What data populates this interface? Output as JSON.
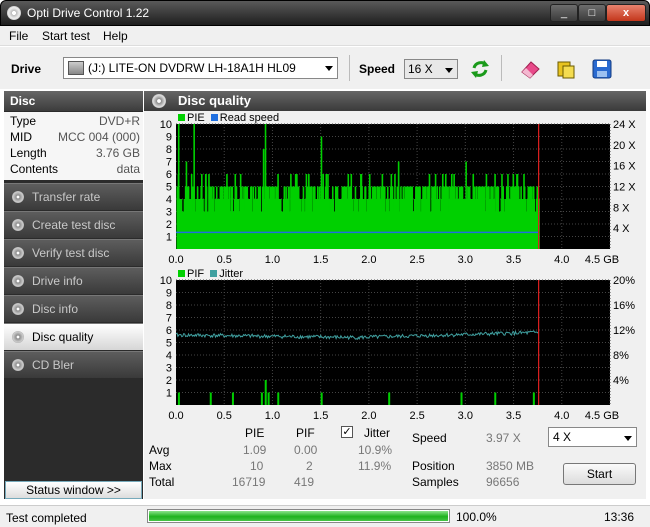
{
  "window": {
    "title": "Opti Drive Control 1.22",
    "min": "_",
    "max": "□",
    "close": "x"
  },
  "menu": [
    "File",
    "Start test",
    "Help"
  ],
  "toolbar": {
    "drive_label": "Drive",
    "drive_value": "(J:)  LITE-ON DVDRW LH-18A1H HL09",
    "speed_label": "Speed",
    "speed_value": "16 X",
    "buttons": [
      "refresh-icon",
      "eraser-icon",
      "copy-icon",
      "save-icon"
    ]
  },
  "sidebar": {
    "header": "Disc",
    "info": [
      {
        "key": "Type",
        "value": "DVD+R"
      },
      {
        "key": "MID",
        "value": "MCC 004 (000)"
      },
      {
        "key": "Length",
        "value": "3.76 GB"
      },
      {
        "key": "Contents",
        "value": "data"
      }
    ],
    "nav": [
      {
        "label": "Transfer rate",
        "active": false
      },
      {
        "label": "Create test disc",
        "active": false
      },
      {
        "label": "Verify test disc",
        "active": false
      },
      {
        "label": "Drive info",
        "active": false
      },
      {
        "label": "Disc info",
        "active": false
      },
      {
        "label": "Disc quality",
        "active": true
      },
      {
        "label": "CD Bler",
        "active": false
      }
    ],
    "status_window_btn": "Status window >>"
  },
  "main": {
    "title": "Disc quality",
    "legend_top": {
      "pie": "PIE",
      "read": "Read speed"
    },
    "legend_bottom": {
      "pif": "PIF",
      "jitter": "Jitter"
    }
  },
  "chart_data": [
    {
      "type": "bar",
      "name": "PIE / Read speed",
      "x_range": [
        0,
        4.5
      ],
      "x_ticks": [
        "0.0",
        "0.5",
        "1.0",
        "1.5",
        "2.0",
        "2.5",
        "3.0",
        "3.5",
        "4.0",
        "4.5 GB"
      ],
      "y_left_ticks": [
        "1",
        "2",
        "3",
        "4",
        "5",
        "6",
        "7",
        "8",
        "9",
        "10"
      ],
      "y_left_range": [
        0,
        10
      ],
      "y_right_ticks": [
        "4 X",
        "8 X",
        "12 X",
        "16 X",
        "20 X",
        "24 X"
      ],
      "y_right_range": [
        0,
        24
      ],
      "disc_end": 3.76,
      "pie_base": 4,
      "pie_spikes": [
        [
          0.02,
          10
        ],
        [
          0.1,
          7
        ],
        [
          0.18,
          10
        ],
        [
          0.3,
          6
        ],
        [
          0.52,
          6
        ],
        [
          0.9,
          8
        ],
        [
          0.92,
          10
        ],
        [
          1.05,
          6
        ],
        [
          1.5,
          9
        ],
        [
          1.55,
          6
        ],
        [
          2.0,
          6
        ],
        [
          2.3,
          7
        ],
        [
          2.62,
          6
        ],
        [
          3.0,
          7
        ],
        [
          3.3,
          6
        ],
        [
          3.6,
          6
        ],
        [
          3.7,
          5
        ]
      ],
      "read_speed_x": 3.2,
      "colors": {
        "pie": "#00d000",
        "read": "#1f6fe0",
        "end": "#e02020"
      }
    },
    {
      "type": "bar",
      "name": "PIF / Jitter",
      "x_range": [
        0,
        4.5
      ],
      "x_ticks": [
        "0.0",
        "0.5",
        "1.0",
        "1.5",
        "2.0",
        "2.5",
        "3.0",
        "3.5",
        "4.0",
        "4.5 GB"
      ],
      "y_left_ticks": [
        "1",
        "2",
        "3",
        "4",
        "5",
        "6",
        "7",
        "8",
        "9",
        "10"
      ],
      "y_left_range": [
        0,
        10
      ],
      "y_right_ticks": [
        "4%",
        "8%",
        "12%",
        "16%",
        "20%"
      ],
      "y_right_range": [
        0,
        20
      ],
      "disc_end": 3.76,
      "pif_bars": [
        [
          0.02,
          1
        ],
        [
          0.35,
          1
        ],
        [
          0.58,
          1
        ],
        [
          0.88,
          1
        ],
        [
          0.92,
          2
        ],
        [
          0.95,
          1
        ],
        [
          1.05,
          1
        ],
        [
          1.5,
          1
        ],
        [
          2.2,
          1
        ],
        [
          2.95,
          1
        ],
        [
          3.3,
          1
        ],
        [
          3.7,
          1
        ]
      ],
      "jitter_start": 11.2,
      "jitter_mid": 10.8,
      "jitter_end": 11.6,
      "colors": {
        "pif": "#00d000",
        "jitter": "#40a0a0",
        "end": "#e02020"
      }
    }
  ],
  "stats": {
    "col_pie": "PIE",
    "col_pif": "PIF",
    "jitter_label": "Jitter",
    "jitter_checked": "✓",
    "rows": [
      {
        "label": "Avg",
        "pie": "1.09",
        "pif": "0.00",
        "jitter": "10.9%"
      },
      {
        "label": "Max",
        "pie": "10",
        "pif": "2",
        "jitter": "11.9%"
      },
      {
        "label": "Total",
        "pie": "16719",
        "pif": "419",
        "jitter": ""
      }
    ],
    "speed_label": "Speed",
    "speed_value": "3.97 X",
    "speed_combo": "4 X",
    "position_label": "Position",
    "position_value": "3850 MB",
    "samples_label": "Samples",
    "samples_value": "96656",
    "start_btn": "Start"
  },
  "statusbar": {
    "text": "Test completed",
    "progress": 100,
    "progress_text": "100.0%",
    "time": "13:36"
  }
}
